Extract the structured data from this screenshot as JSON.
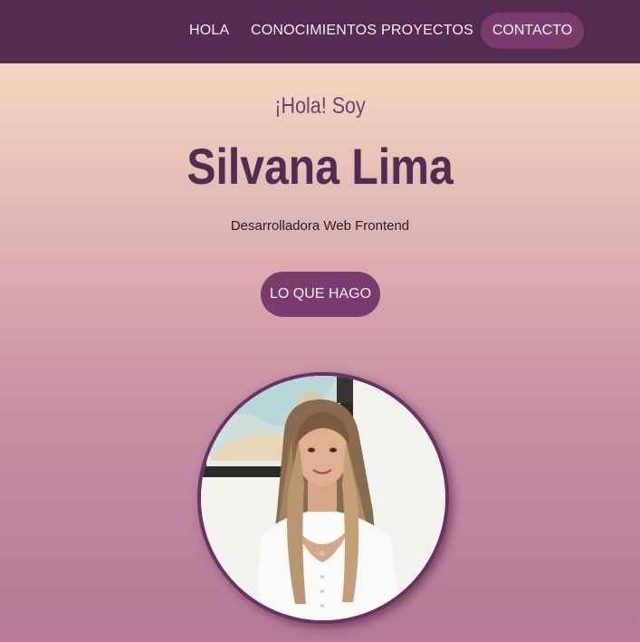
{
  "nav": {
    "items": [
      {
        "label": "HOLA"
      },
      {
        "label": "CONOCIMIENTOS"
      },
      {
        "label": "PROYECTOS"
      }
    ],
    "contact_label": "CONTACTO"
  },
  "hero": {
    "greeting": "¡Hola! Soy",
    "name": "Silvana Lima",
    "role": "Desarrolladora Web Frontend",
    "cta_label": "LO QUE HAGO"
  },
  "colors": {
    "navbar": "#522c52",
    "accent": "#7a3c6e",
    "name_text": "#522c52"
  },
  "icons": {
    "avatar": "profile-photo"
  }
}
